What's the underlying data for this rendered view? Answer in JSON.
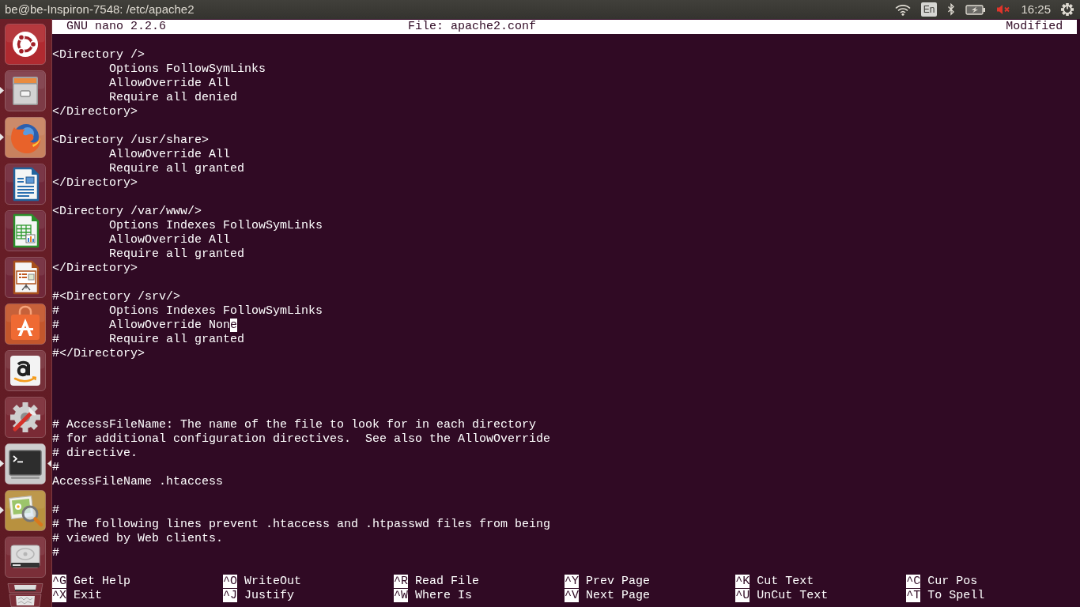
{
  "window": {
    "title": "be@be-Inspiron-7548: /etc/apache2"
  },
  "panel": {
    "keyboard_layout": "En",
    "sound_muted": true,
    "clock": "16:25"
  },
  "launcher": {
    "items": [
      {
        "kind": "dash",
        "running": false,
        "focused": false
      },
      {
        "kind": "files",
        "running": true,
        "focused": false
      },
      {
        "kind": "browser",
        "running": true,
        "focused": false
      },
      {
        "kind": "writer",
        "running": false,
        "focused": false
      },
      {
        "kind": "calc",
        "running": false,
        "focused": false
      },
      {
        "kind": "impress",
        "running": false,
        "focused": false
      },
      {
        "kind": "software",
        "running": false,
        "focused": false
      },
      {
        "kind": "amazon",
        "running": false,
        "focused": false
      },
      {
        "kind": "settings",
        "running": false,
        "focused": false
      },
      {
        "kind": "terminal",
        "running": true,
        "focused": true
      },
      {
        "kind": "viewer",
        "running": true,
        "focused": false
      },
      {
        "kind": "drive",
        "running": false,
        "focused": false
      },
      {
        "kind": "stack",
        "running": false,
        "focused": false
      }
    ]
  },
  "nano": {
    "version": "GNU nano 2.2.6",
    "file": "File: apache2.conf",
    "status": "Modified",
    "lines": [
      {
        "kind": "blank"
      },
      {
        "kind": "text",
        "text": "<Directory />"
      },
      {
        "kind": "text",
        "text": "\tOptions FollowSymLinks"
      },
      {
        "kind": "text",
        "text": "\tAllowOverride All"
      },
      {
        "kind": "text",
        "text": "\tRequire all denied"
      },
      {
        "kind": "text",
        "text": "</Directory>"
      },
      {
        "kind": "blank"
      },
      {
        "kind": "text",
        "text": "<Directory /usr/share>"
      },
      {
        "kind": "text",
        "text": "\tAllowOverride All"
      },
      {
        "kind": "text",
        "text": "\tRequire all granted"
      },
      {
        "kind": "text",
        "text": "</Directory>"
      },
      {
        "kind": "blank"
      },
      {
        "kind": "text",
        "text": "<Directory /var/www/>"
      },
      {
        "kind": "text",
        "text": "\tOptions Indexes FollowSymLinks"
      },
      {
        "kind": "text",
        "text": "\tAllowOverride All"
      },
      {
        "kind": "text",
        "text": "\tRequire all granted"
      },
      {
        "kind": "text",
        "text": "</Directory>"
      },
      {
        "kind": "blank"
      },
      {
        "kind": "text",
        "text": "#<Directory /srv/>"
      },
      {
        "kind": "text",
        "text": "#\tOptions Indexes FollowSymLinks"
      },
      {
        "kind": "text",
        "text": "#\tAllowOverride Non",
        "cursor": "e"
      },
      {
        "kind": "text",
        "text": "#\tRequire all granted"
      },
      {
        "kind": "text",
        "text": "#</Directory>"
      },
      {
        "kind": "blank"
      },
      {
        "kind": "blank"
      },
      {
        "kind": "blank"
      },
      {
        "kind": "blank"
      },
      {
        "kind": "text",
        "text": "# AccessFileName: The name of the file to look for in each directory"
      },
      {
        "kind": "text",
        "text": "# for additional configuration directives.  See also the AllowOverride"
      },
      {
        "kind": "text",
        "text": "# directive."
      },
      {
        "kind": "text",
        "text": "#"
      },
      {
        "kind": "text",
        "text": "AccessFileName .htaccess"
      },
      {
        "kind": "blank"
      },
      {
        "kind": "text",
        "text": "#"
      },
      {
        "kind": "text",
        "text": "# The following lines prevent .htaccess and .htpasswd files from being"
      },
      {
        "kind": "text",
        "text": "# viewed by Web clients."
      },
      {
        "kind": "text",
        "text": "#"
      },
      {
        "kind": "blank"
      }
    ],
    "shortcuts": [
      {
        "key": "^G",
        "label": "Get Help"
      },
      {
        "key": "^O",
        "label": "WriteOut"
      },
      {
        "key": "^R",
        "label": "Read File"
      },
      {
        "key": "^Y",
        "label": "Prev Page"
      },
      {
        "key": "^K",
        "label": "Cut Text"
      },
      {
        "key": "^C",
        "label": "Cur Pos"
      },
      {
        "key": "^X",
        "label": "Exit"
      },
      {
        "key": "^J",
        "label": "Justify"
      },
      {
        "key": "^W",
        "label": "Where Is"
      },
      {
        "key": "^V",
        "label": "Next Page"
      },
      {
        "key": "^U",
        "label": "UnCut Text"
      },
      {
        "key": "^T",
        "label": "To Spell"
      }
    ]
  }
}
